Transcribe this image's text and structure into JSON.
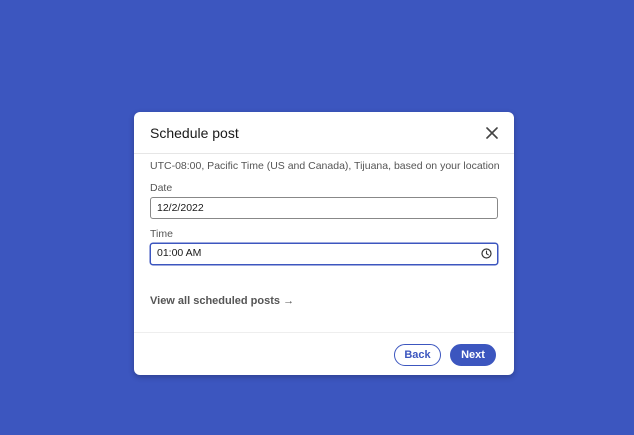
{
  "modal": {
    "title": "Schedule post",
    "timezone_text": "UTC-08:00, Pacific Time (US and Canada), Tijuana, based on your location",
    "date_label": "Date",
    "date_value": "12/2/2022",
    "time_label": "Time",
    "time_value": "01:00 AM",
    "view_link": "View all scheduled posts →",
    "back_label": "Back",
    "next_label": "Next"
  },
  "icons": {
    "close": "close-icon",
    "clock": "clock-icon"
  },
  "colors": {
    "background": "#3c56bf",
    "accent": "#3c56bf",
    "modal": "#ffffff"
  }
}
